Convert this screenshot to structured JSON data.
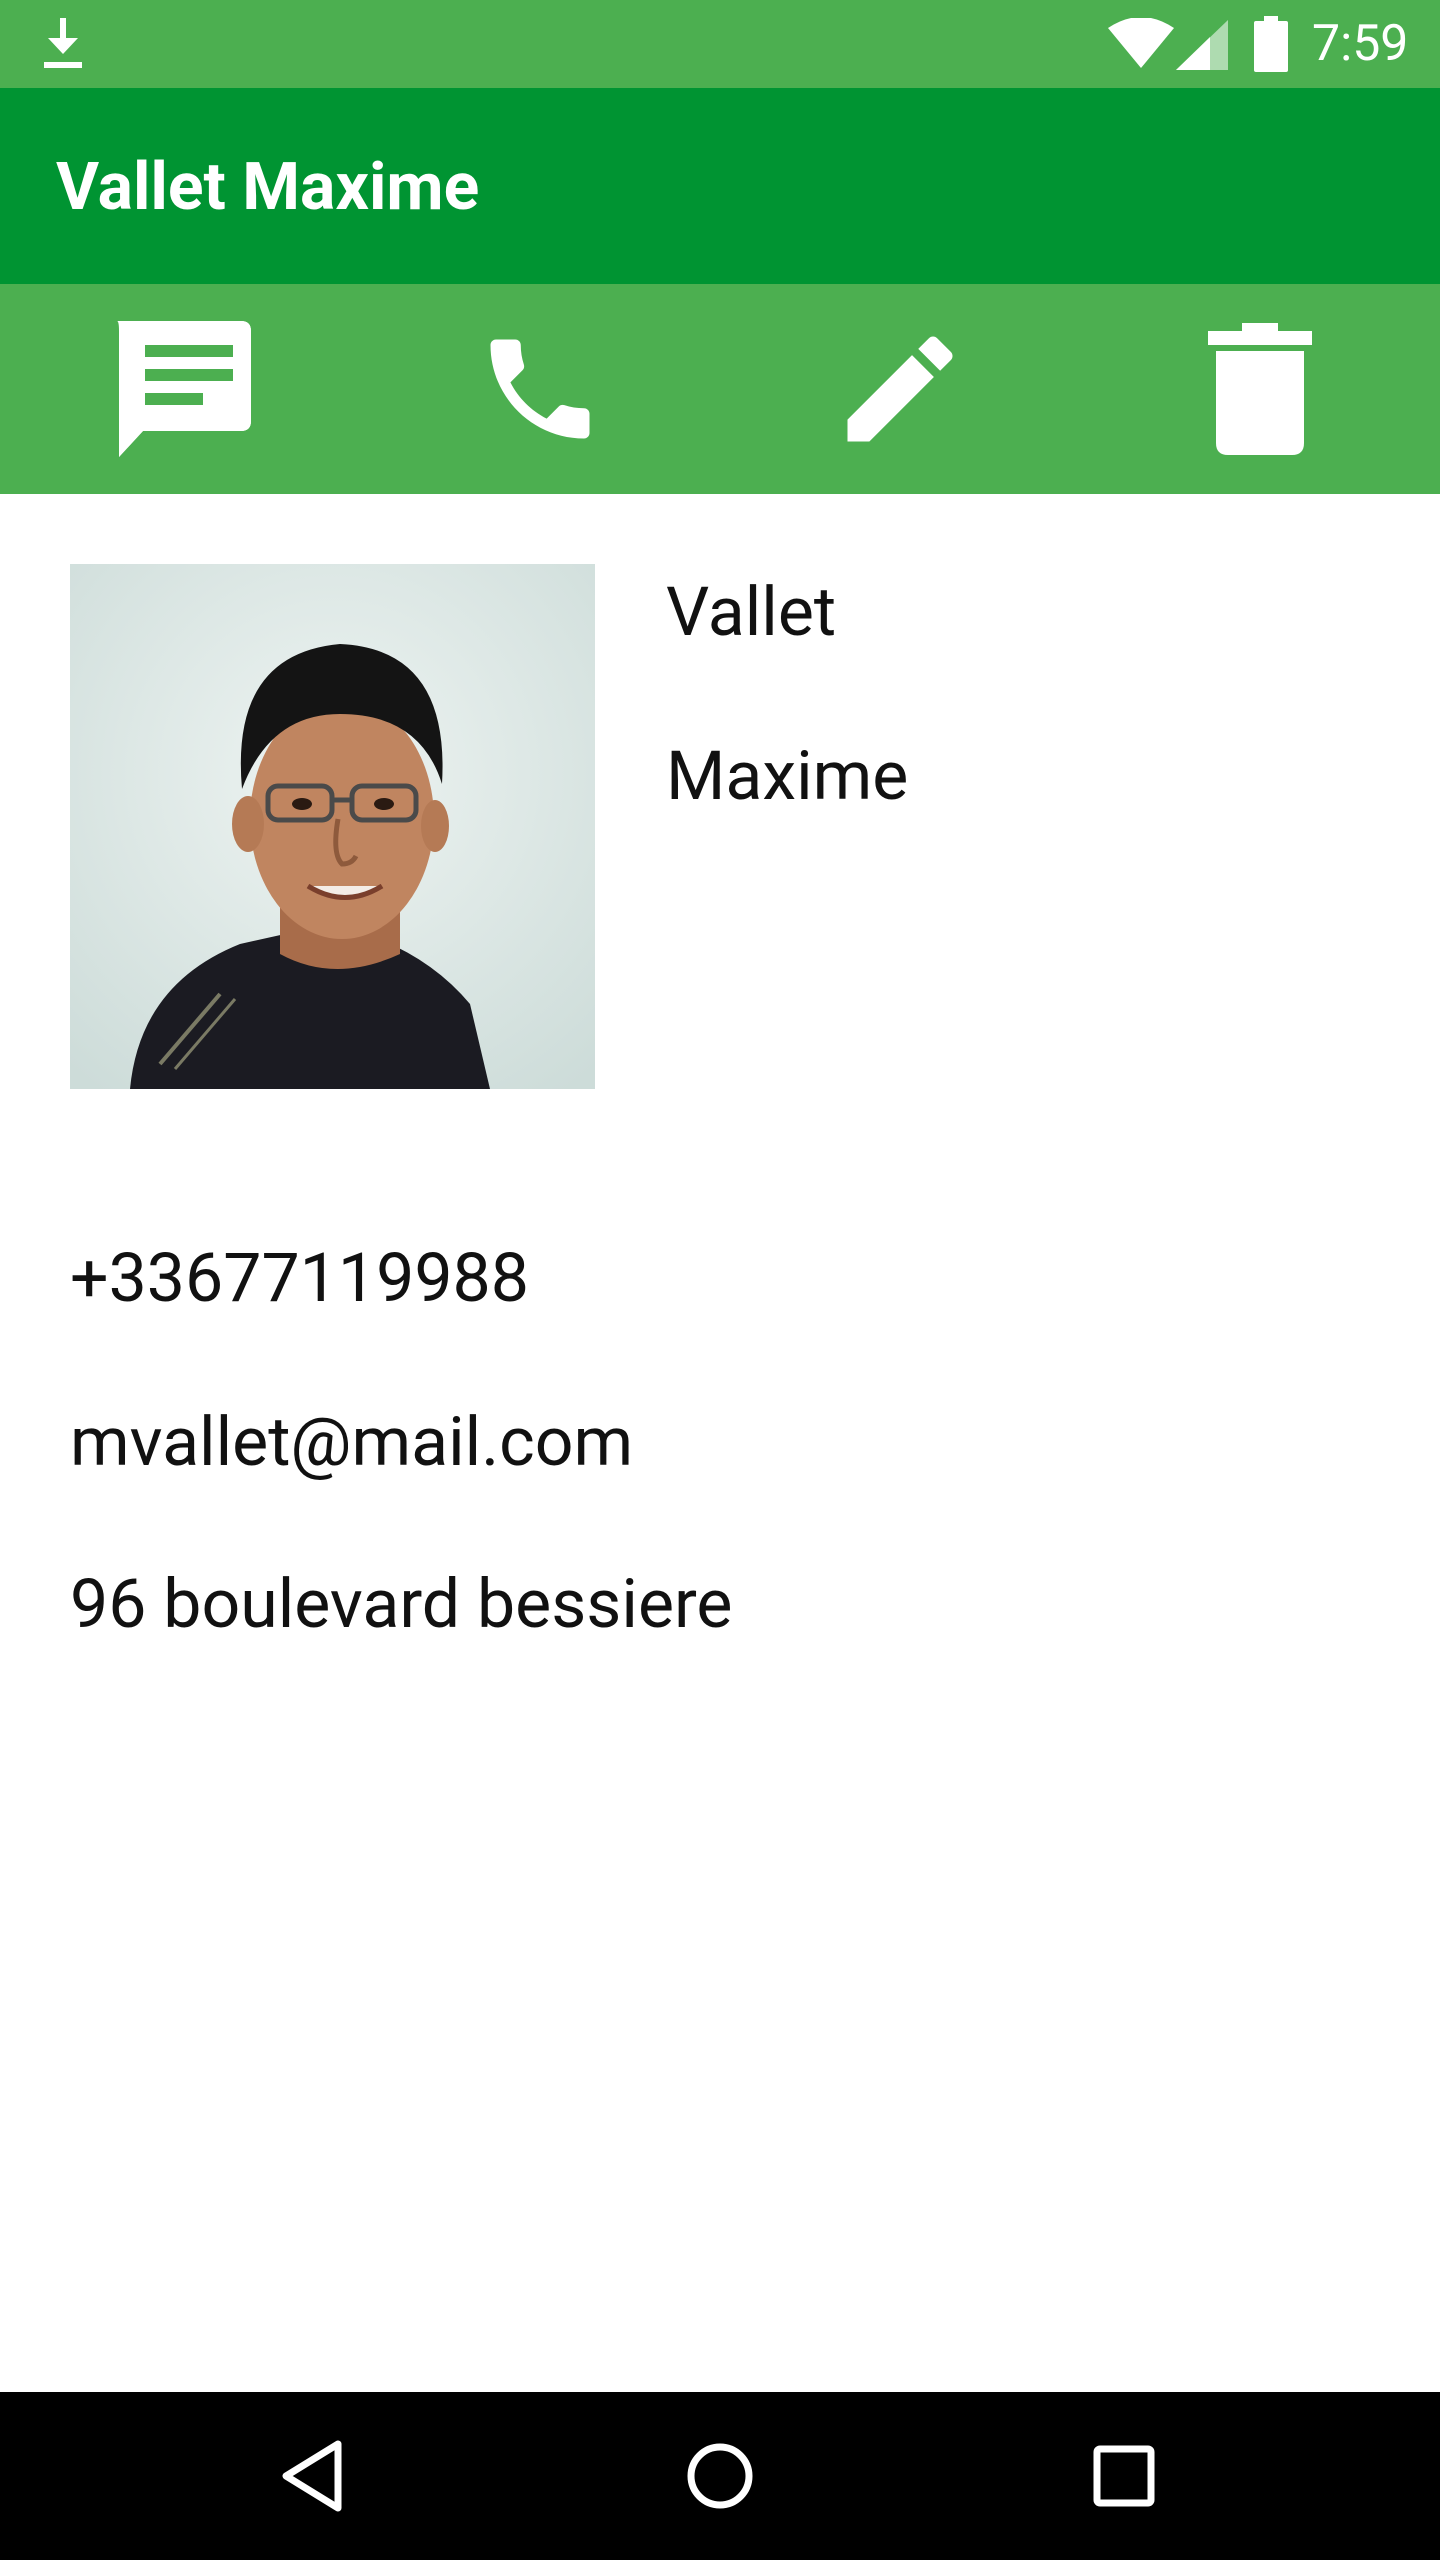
{
  "status_bar": {
    "time": "7:59",
    "icons": [
      "download-icon",
      "wifi-icon",
      "signal-icon",
      "battery-icon"
    ]
  },
  "app_bar": {
    "title": "Vallet Maxime"
  },
  "actions": [
    {
      "name": "message-button",
      "icon": "message-icon"
    },
    {
      "name": "call-button",
      "icon": "phone-icon"
    },
    {
      "name": "edit-button",
      "icon": "pencil-icon"
    },
    {
      "name": "delete-button",
      "icon": "trash-icon"
    }
  ],
  "contact": {
    "last_name": "Vallet",
    "first_name": "Maxime",
    "phone": "+33677119988",
    "email": "mvallet@mail.com",
    "address": "96 boulevard bessiere"
  },
  "nav_bar": {
    "buttons": [
      "back-icon",
      "home-icon",
      "recents-icon"
    ]
  },
  "colors": {
    "status_bar": "#4caf50",
    "app_bar": "#009432",
    "action_bar": "#4caf50",
    "nav_bar": "#000000"
  }
}
